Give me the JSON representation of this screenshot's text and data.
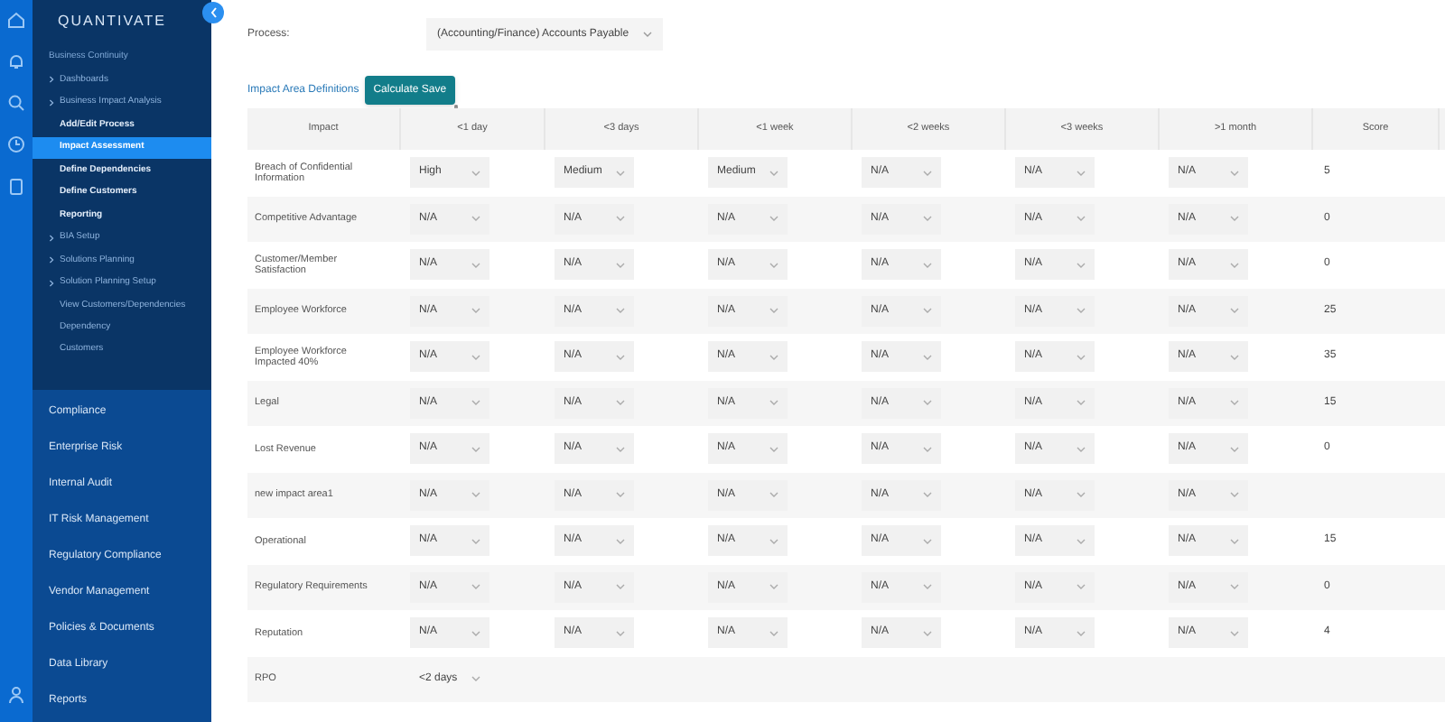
{
  "brand": "QUANTIVATE",
  "sidebar": {
    "items": [
      {
        "label": "Business Continuity",
        "kind": "heading",
        "selected": false
      },
      {
        "label": "Dashboards",
        "kind": "group",
        "selected": false
      },
      {
        "label": "Business Impact Analysis",
        "kind": "group",
        "selected": false
      },
      {
        "label": "Add/Edit Process",
        "kind": "link",
        "selected": false
      },
      {
        "label": "Impact Assessment",
        "kind": "link",
        "selected": true
      },
      {
        "label": "Define Dependencies",
        "kind": "link",
        "selected": false
      },
      {
        "label": "Define Customers",
        "kind": "link",
        "selected": false
      },
      {
        "label": "Reporting",
        "kind": "link",
        "selected": false
      },
      {
        "label": "BIA Setup",
        "kind": "group",
        "selected": false
      },
      {
        "label": "Solutions Planning",
        "kind": "group",
        "selected": false
      },
      {
        "label": "Solution Planning Setup",
        "kind": "group",
        "selected": false
      },
      {
        "label": "View Customers/Dependencies",
        "kind": "sublink",
        "selected": false
      },
      {
        "label": "Dependency",
        "kind": "sublink",
        "selected": false
      },
      {
        "label": "Customers",
        "kind": "sublink",
        "selected": false
      }
    ],
    "modules": [
      "Compliance",
      "Enterprise Risk",
      "Internal Audit",
      "IT Risk Management",
      "Regulatory Compliance",
      "Vendor Management",
      "Policies & Documents",
      "Data Library",
      "Reports"
    ]
  },
  "process": {
    "label": "Process:",
    "value": "(Accounting/Finance) Accounts Payable"
  },
  "impact_area_link": "Impact Area Definitions",
  "calculate_button": "Calculate Save",
  "table": {
    "columns": [
      "Impact",
      "<1 day",
      "<3 days",
      "<1 week",
      "<2 weeks",
      "<3 weeks",
      ">1 month",
      "Score"
    ],
    "rows": [
      {
        "impact": "Breach of Confidential Information",
        "values": [
          "High",
          "Medium",
          "Medium",
          "N/A",
          "N/A",
          "N/A"
        ],
        "score": "5"
      },
      {
        "impact": "Competitive Advantage",
        "values": [
          "N/A",
          "N/A",
          "N/A",
          "N/A",
          "N/A",
          "N/A"
        ],
        "score": "0"
      },
      {
        "impact": "Customer/Member Satisfaction",
        "values": [
          "N/A",
          "N/A",
          "N/A",
          "N/A",
          "N/A",
          "N/A"
        ],
        "score": "0"
      },
      {
        "impact": "Employee Workforce",
        "values": [
          "N/A",
          "N/A",
          "N/A",
          "N/A",
          "N/A",
          "N/A"
        ],
        "score": "25"
      },
      {
        "impact": "Employee Workforce Impacted 40%",
        "values": [
          "N/A",
          "N/A",
          "N/A",
          "N/A",
          "N/A",
          "N/A"
        ],
        "score": "35"
      },
      {
        "impact": "Legal",
        "values": [
          "N/A",
          "N/A",
          "N/A",
          "N/A",
          "N/A",
          "N/A"
        ],
        "score": "15"
      },
      {
        "impact": "Lost Revenue",
        "values": [
          "N/A",
          "N/A",
          "N/A",
          "N/A",
          "N/A",
          "N/A"
        ],
        "score": "0"
      },
      {
        "impact": "new impact area1",
        "values": [
          "N/A",
          "N/A",
          "N/A",
          "N/A",
          "N/A",
          "N/A"
        ]
      },
      {
        "impact": "Operational",
        "values": [
          "N/A",
          "N/A",
          "N/A",
          "N/A",
          "N/A",
          "N/A"
        ],
        "score": "15"
      },
      {
        "impact": "Regulatory Requirements",
        "values": [
          "N/A",
          "N/A",
          "N/A",
          "N/A",
          "N/A",
          "N/A"
        ],
        "score": "0"
      },
      {
        "impact": "Reputation",
        "values": [
          "N/A",
          "N/A",
          "N/A",
          "N/A",
          "N/A",
          "N/A"
        ],
        "score": "4"
      }
    ],
    "rpo": {
      "label": "RPO",
      "value": "<2 days"
    }
  }
}
